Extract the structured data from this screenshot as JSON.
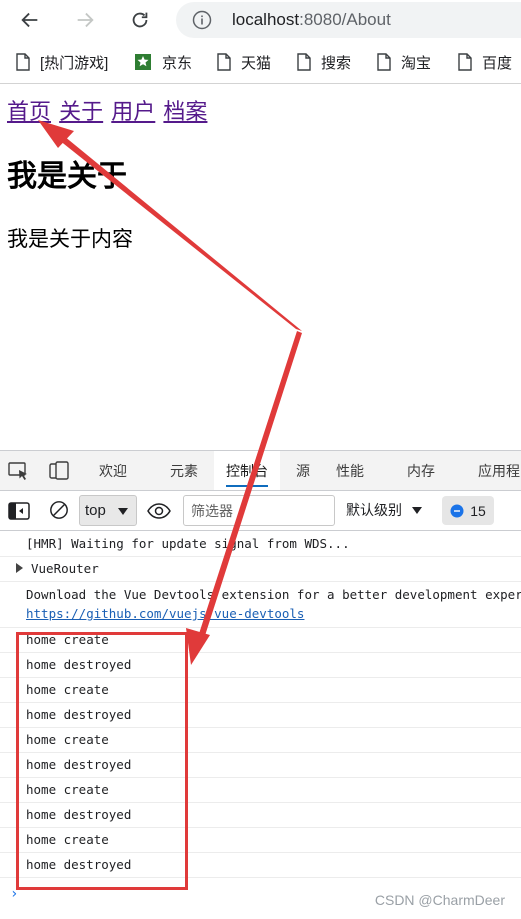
{
  "browser": {
    "url_host": "localhost",
    "url_port_path": ":8080/About",
    "bookmarks": [
      "[热门游戏]",
      "京东",
      "天猫",
      "搜索",
      "淘宝",
      "百度"
    ]
  },
  "page": {
    "links": [
      "首页",
      "关于",
      "用户",
      "档案"
    ],
    "title": "我是关于",
    "content": "我是关于内容"
  },
  "devtools": {
    "tabs": [
      "欢迎",
      "元素",
      "控制台",
      "源",
      "性能",
      "内存",
      "应用程"
    ],
    "active_tab": "控制台",
    "context": "top",
    "filter_placeholder": "筛选器",
    "level": "默认级别",
    "message_count": "15",
    "console": {
      "hmr": "[HMR] Waiting for update signal from WDS...",
      "vue_router": "VueRouter",
      "devtools_msg": "Download the Vue Devtools extension for a better development experience:",
      "devtools_link": "https://github.com/vuejs/vue-devtools",
      "lines": [
        "home create",
        "home destroyed",
        "home create",
        "home destroyed",
        "home create",
        "home destroyed",
        "home create",
        "home destroyed",
        "home create",
        "home destroyed"
      ]
    }
  },
  "watermark": "CSDN @CharmDeer",
  "colors": {
    "annotation": "#e03a3a",
    "link_visited": "#551a8b",
    "active_tab_underline": "#0f6cbd"
  }
}
